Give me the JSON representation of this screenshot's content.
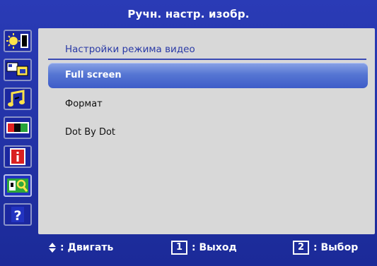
{
  "window": {
    "title": "Ручн. настр. изобр."
  },
  "sidebar": {
    "items": [
      {
        "icon": "brightness-contrast-icon"
      },
      {
        "icon": "position-icon"
      },
      {
        "icon": "audio-icon"
      },
      {
        "icon": "color-icon"
      },
      {
        "icon": "information-icon"
      },
      {
        "icon": "manual-image-setup-icon",
        "active": true
      },
      {
        "icon": "help-icon"
      }
    ]
  },
  "panel": {
    "title": "Настройки режима видео",
    "items": [
      {
        "label": "Full screen",
        "selected": true
      },
      {
        "label": "Формат"
      },
      {
        "label": "Dot By Dot"
      }
    ]
  },
  "footer": {
    "move_label": ": Двигать",
    "exit_key": "1",
    "exit_label": ": Выход",
    "select_key": "2",
    "select_label": ": Выбор"
  },
  "colors": {
    "background": "#1f2fa0",
    "panel": "#d8d8d8",
    "selection": "#5676d3",
    "title_text": "#2a3aa6"
  }
}
